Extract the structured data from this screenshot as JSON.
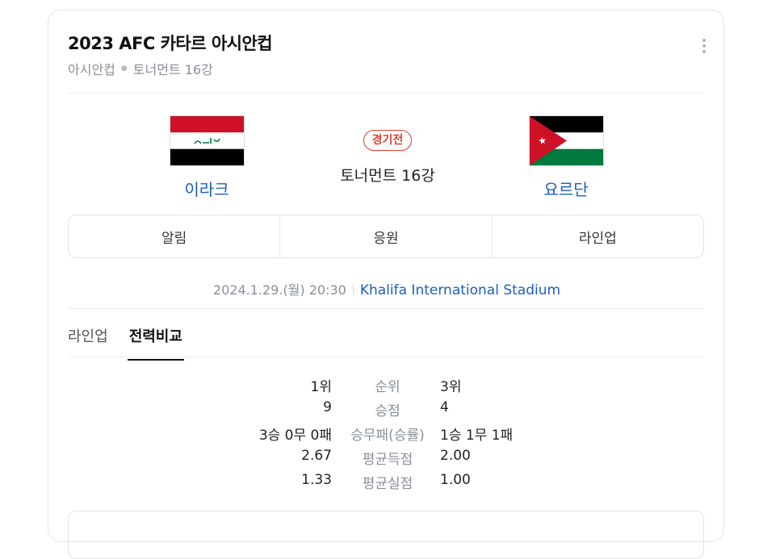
{
  "header": {
    "title": "2023 AFC 카타르 아시안컵",
    "breadcrumb": [
      "아시안컵",
      "토너먼트 16강"
    ]
  },
  "match": {
    "home": {
      "name": "이라크",
      "flag": "iraq-flag-icon"
    },
    "away": {
      "name": "요르단",
      "flag": "jordan-flag-icon"
    },
    "status": "경기전",
    "round": "토너먼트 16강",
    "datetime": "2024.1.29.(월) 20:30",
    "stadium": "Khalifa International Stadium"
  },
  "actions": [
    "알림",
    "응원",
    "라인업"
  ],
  "tabs": [
    {
      "label": "라인업",
      "active": false
    },
    {
      "label": "전력비교",
      "active": true
    }
  ],
  "stats": [
    {
      "label": "순위",
      "home": "1위",
      "away": "3위"
    },
    {
      "label": "승점",
      "home": "9",
      "away": "4"
    },
    {
      "label": "승무패(승률)",
      "home": "3승 0무 0패",
      "away": "1승 1무 1패"
    },
    {
      "label": "평균득점",
      "home": "2.67",
      "away": "2.00"
    },
    {
      "label": "평균실점",
      "home": "1.33",
      "away": "1.00"
    }
  ],
  "colors": {
    "link": "#1b5ec1",
    "status": "#e0412f",
    "muted": "#8a8f97"
  }
}
